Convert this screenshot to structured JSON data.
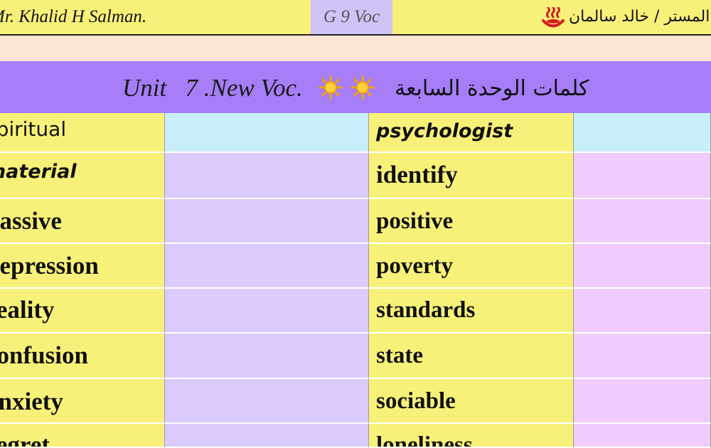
{
  "header": {
    "teacher_en": "Mr. Khalid H Salman.",
    "grade_label": "G 9 Voc",
    "teacher_ar": "المستر / خالد سالمان",
    "icon": "hot-springs-icon"
  },
  "title": {
    "english": "Unit   7 .New Voc.",
    "arabic": "كلمات الوحدة السابعة",
    "icons": [
      "sun-icon",
      "sun-icon"
    ]
  },
  "table": {
    "rows": [
      {
        "left": "spiritual",
        "right": "psychologist"
      },
      {
        "left": "material",
        "right": "identify"
      },
      {
        "left": "passive",
        "right": "positive"
      },
      {
        "left": "depression",
        "right": "poverty"
      },
      {
        "left": "reality",
        "right": "standards"
      },
      {
        "left": "confusion",
        "right": "state"
      },
      {
        "left": "anxiety",
        "right": "sociable"
      },
      {
        "left": "regret",
        "right": "loneliness"
      }
    ]
  },
  "colors": {
    "yellow": "#f8f179",
    "lavender": "#dbcafc",
    "pink": "#efccfb",
    "light_blue": "#c8eefc",
    "purple_bar": "#a57ef8",
    "peach": "#fde5d6"
  }
}
